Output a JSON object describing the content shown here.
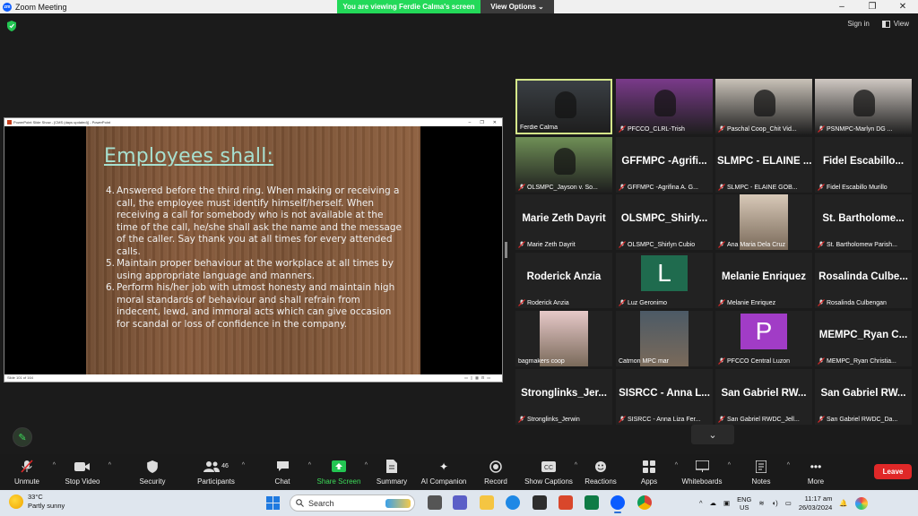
{
  "window": {
    "title": "Zoom Meeting",
    "controls": [
      "–",
      "❐",
      "✕"
    ]
  },
  "share_banner": {
    "message": "You are viewing Ferdie Calma's screen",
    "options_label": "View Options"
  },
  "top_right": {
    "sign_in": "Sign in",
    "view": "View"
  },
  "presentation": {
    "window_title": "PowerPoint Slide Show - [CMS (days updated)] - PowerPoint",
    "status_text": "Slide 101 of 164",
    "slide_title": "Employees shall:",
    "items": [
      {
        "num": "4.",
        "text": "Answered before the third ring. When making or receiving a call, the employee must identify himself/herself. When receiving a call for somebody who is not available at the time of the call, he/she shall ask the name and the message of the caller. Say thank you at all times for every attended calls."
      },
      {
        "num": "5.",
        "text": "Maintain proper behaviour at the workplace at all times by using appropriate language and manners."
      },
      {
        "num": "6.",
        "text": "Perform his/her job with utmost honesty and maintain high moral standards of behaviour and shall refrain from indecent, lewd, and immoral acts which can give occasion for scandal or loss of confidence in the company."
      }
    ]
  },
  "participants": [
    {
      "kind": "video",
      "label": "Ferdie Calma",
      "active": true,
      "muted": false,
      "bg": "#3a3f44"
    },
    {
      "kind": "video",
      "label": "PFCCO_CLRL-Trish",
      "muted": true,
      "bg": "#7a3a8a"
    },
    {
      "kind": "video",
      "label": "Paschal Coop_Chit Vid...",
      "muted": true,
      "bg": "#c9c2b8"
    },
    {
      "kind": "video",
      "label": "PSNMPC-Marlyn DG ...",
      "muted": true,
      "bg": "#cfc8c2"
    },
    {
      "kind": "video",
      "label": "OLSMPC_Jayson v. So...",
      "muted": true,
      "bg": "#6f8f56"
    },
    {
      "kind": "name",
      "big": "GFFMPC -Agrifi...",
      "label": "GFFMPC -Agrifina A. G...",
      "muted": true
    },
    {
      "kind": "name",
      "big": "SLMPC - ELAINE ...",
      "label": "SLMPC - ELAINE GOB...",
      "muted": true
    },
    {
      "kind": "name",
      "big": "Fidel Escabillo...",
      "label": "Fidel Escabillo Murillo",
      "muted": true
    },
    {
      "kind": "name",
      "big": "Marie Zeth Dayrit",
      "label": "Marie Zeth Dayrit",
      "muted": true
    },
    {
      "kind": "name",
      "big": "OLSMPC_Shirly...",
      "label": "OLSMPC_Shirlyn Cubio",
      "muted": true
    },
    {
      "kind": "photo",
      "label": "Ana Maria Dela Cruz",
      "muted": true,
      "bg": "#d8c9b8"
    },
    {
      "kind": "name",
      "big": "St. Bartholome...",
      "label": "St. Bartholomew Parish...",
      "muted": true
    },
    {
      "kind": "name",
      "big": "Roderick Anzia",
      "label": "Roderick Anzia",
      "muted": true
    },
    {
      "kind": "avatar",
      "letter": "L",
      "label": "Luz Geronimo",
      "muted": true,
      "color": "#1f6b4e"
    },
    {
      "kind": "name",
      "big": "Melanie Enriquez",
      "label": "Melanie Enriquez",
      "muted": true
    },
    {
      "kind": "name",
      "big": "Rosalinda Culbe...",
      "label": "Rosalinda Culbengan",
      "muted": true
    },
    {
      "kind": "photo",
      "label": "bagmakers coop",
      "muted": false,
      "bg": "#e7c9c9"
    },
    {
      "kind": "photo",
      "label": "Catmon MPC mar",
      "muted": false,
      "bg": "#4c5a66"
    },
    {
      "kind": "avatar",
      "letter": "P",
      "label": "PFCCO Central Luzon",
      "muted": true,
      "color": "#a13cc6"
    },
    {
      "kind": "name",
      "big": "MEMPC_Ryan C...",
      "label": "MEMPC_Ryan Christia...",
      "muted": true
    },
    {
      "kind": "name",
      "big": "Stronglinks_Jer...",
      "label": "Stronglinks_Jerwin",
      "muted": true
    },
    {
      "kind": "name",
      "big": "SISRCC - Anna L...",
      "label": "SISRCC - Anna Liza Fer...",
      "muted": true
    },
    {
      "kind": "name",
      "big": "San Gabriel RW...",
      "label": "San Gabriel RWDC_Jell...",
      "muted": true
    },
    {
      "kind": "name",
      "big": "San Gabriel RW...",
      "label": "San Gabriel RWDC_Da...",
      "muted": true
    }
  ],
  "toolbar": {
    "unmute": "Unmute",
    "stop_video": "Stop Video",
    "security": "Security",
    "participants": "Participants",
    "participants_count": "46",
    "chat": "Chat",
    "share_screen": "Share Screen",
    "summary": "Summary",
    "ai_companion": "AI Companion",
    "record": "Record",
    "show_captions": "Show Captions",
    "reactions": "Reactions",
    "apps": "Apps",
    "whiteboards": "Whiteboards",
    "notes": "Notes",
    "more": "More",
    "leave": "Leave"
  },
  "taskbar": {
    "temperature": "33°C",
    "weather": "Partly sunny",
    "search_placeholder": "Search",
    "lang_top": "ENG",
    "lang_bottom": "US",
    "time": "11:17 am",
    "date": "26/03/2024"
  },
  "colors": {
    "accent_green": "#23d959",
    "leave_red": "#e02828",
    "active_border": "#d5e88a"
  }
}
